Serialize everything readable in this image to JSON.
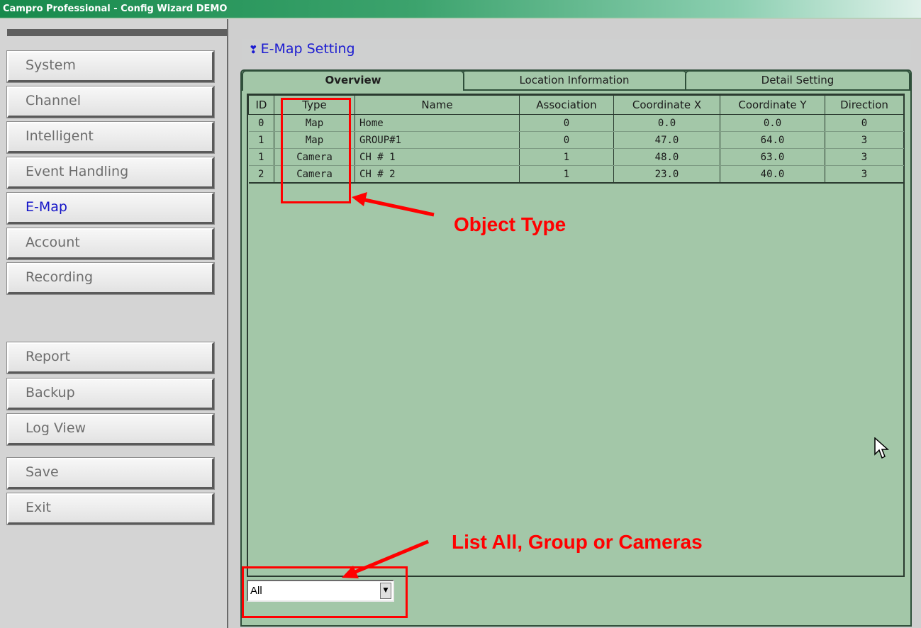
{
  "window": {
    "title": "Campro Professional - Config Wizard DEMO"
  },
  "sidebar": {
    "items": [
      {
        "label": "System"
      },
      {
        "label": "Channel"
      },
      {
        "label": "Intelligent"
      },
      {
        "label": "Event Handling"
      },
      {
        "label": "E-Map"
      },
      {
        "label": "Account"
      },
      {
        "label": "Recording"
      },
      {
        "label": "Report"
      },
      {
        "label": "Backup"
      },
      {
        "label": "Log View"
      },
      {
        "label": "Save"
      },
      {
        "label": "Exit"
      }
    ],
    "active": "E-Map"
  },
  "main": {
    "title": "E-Map Setting",
    "tabs": [
      {
        "label": "Overview"
      },
      {
        "label": "Location Information"
      },
      {
        "label": "Detail Setting"
      }
    ],
    "active_tab": "Overview",
    "table": {
      "columns": [
        "ID",
        "Type",
        "Name",
        "Association",
        "Coordinate X",
        "Coordinate Y",
        "Direction"
      ],
      "rows": [
        [
          "0",
          "Map",
          "Home",
          "0",
          "0.0",
          "0.0",
          "0"
        ],
        [
          "1",
          "Map",
          "GROUP#1",
          "0",
          "47.0",
          "64.0",
          "3"
        ],
        [
          "1",
          "Camera",
          "CH # 1",
          "1",
          "48.0",
          "63.0",
          "3"
        ],
        [
          "2",
          "Camera",
          "CH # 2",
          "1",
          "23.0",
          "40.0",
          "3"
        ]
      ]
    },
    "filter": {
      "value": "All"
    }
  },
  "annotations": {
    "object_type": "Object Type",
    "list_filter": "List All, Group or Cameras",
    "color": "#ff0000"
  },
  "colors": {
    "panel": "#a3c7a8",
    "titlebar": "#178a4c",
    "active_item": "#1414c8"
  }
}
